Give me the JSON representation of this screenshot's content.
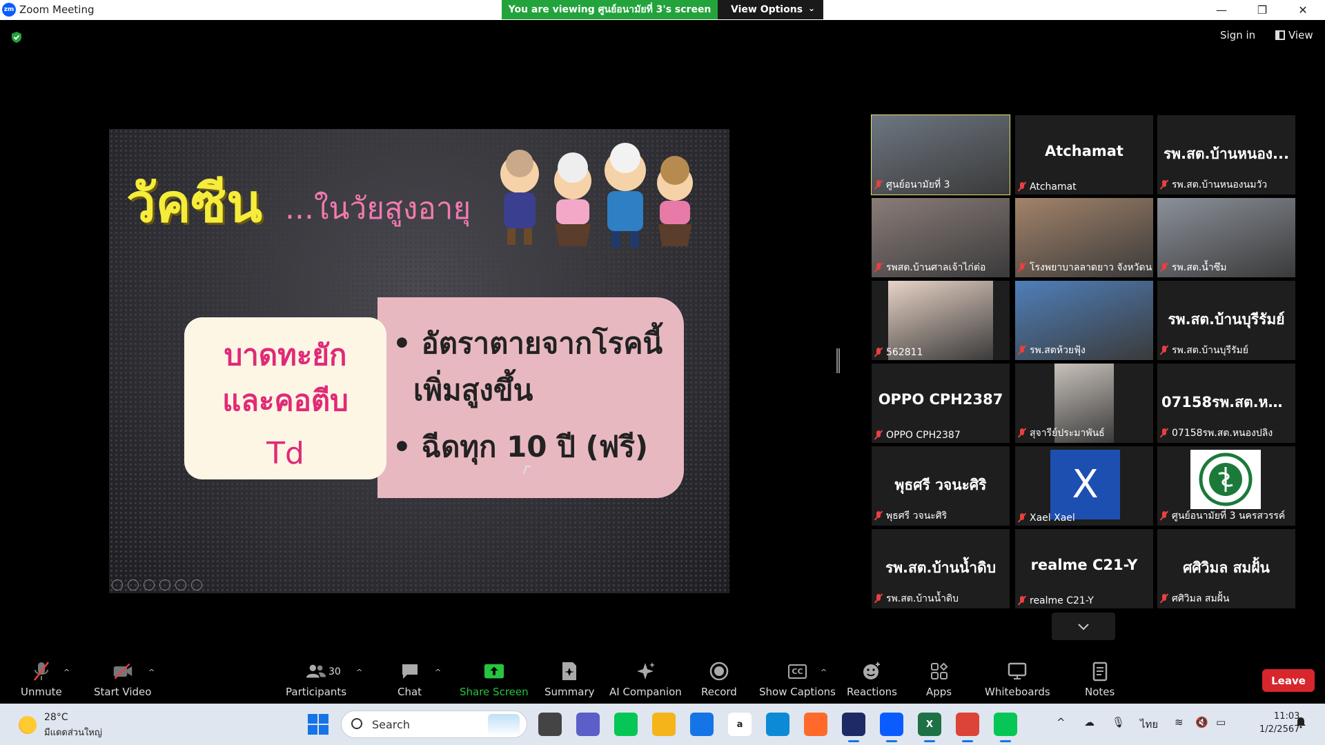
{
  "window": {
    "app_title": "Zoom Meeting",
    "logo_text": "zm",
    "minimize": "—",
    "restore": "❐",
    "close": "✕"
  },
  "banner": {
    "viewing_text": "You are viewing ศูนย์อนามัยที่ 3's screen",
    "view_options_label": "View Options"
  },
  "header": {
    "sign_in": "Sign in",
    "view": "View"
  },
  "slide": {
    "title_main": "วัคซีน",
    "title_sub": "...ในวัยสูงอายุ",
    "card_left_line1": "บาดทะยัก",
    "card_left_line2": "และคอตีบ",
    "card_left_line3": "Td",
    "bullet1_line1": "• อัตราตายจากโรคนี้",
    "bullet1_line2": "เพิ่มสูงขึ้น",
    "bullet2": "• ฉีดทุก 10 ปี (ฟรี)"
  },
  "participants": [
    {
      "display_name": "ศูนย์อนามัยที่ 3",
      "big_label": "",
      "tile_type": "video",
      "active": true,
      "bg": "#6d7681"
    },
    {
      "display_name": "Atchamat",
      "big_label": "Atchamat",
      "tile_type": "name"
    },
    {
      "display_name": "รพ.สต.บ้านหนองนมวัว",
      "big_label": "รพ.สต.บ้านหนอง...",
      "tile_type": "name"
    },
    {
      "display_name": "รพสต.บ้านศาลเจ้าไก่ต่อ",
      "big_label": "",
      "tile_type": "video",
      "bg": "#8a7c78"
    },
    {
      "display_name": "โรงพยาบาลลาดยาว จังหวัดนค...",
      "big_label": "",
      "tile_type": "video",
      "bg": "#a3836a"
    },
    {
      "display_name": "รพ.สต.น้ำซึม",
      "big_label": "",
      "tile_type": "video",
      "bg": "#8b9099"
    },
    {
      "display_name": "562811",
      "big_label": "",
      "tile_type": "video-narrow",
      "bg": "#e8d3c6"
    },
    {
      "display_name": "รพ.สตห้วยฟุ้ง",
      "big_label": "",
      "tile_type": "video",
      "bg": "#4f7fb9"
    },
    {
      "display_name": "รพ.สต.บ้านบุรีรัมย์",
      "big_label": "รพ.สต.บ้านบุรีรัมย์",
      "tile_type": "name"
    },
    {
      "display_name": "OPPO CPH2387",
      "big_label": "OPPO CPH2387",
      "tile_type": "name"
    },
    {
      "display_name": "สุจารีย์ประมาพันธ์",
      "big_label": "",
      "tile_type": "video-portrait",
      "bg": "#c9c2bb"
    },
    {
      "display_name": "07158รพ.สต.หนองปลิง",
      "big_label": "07158รพ.สต.หน...",
      "tile_type": "name"
    },
    {
      "display_name": "พุธศรี วจนะศิริ",
      "big_label": "พุธศรี วจนะศิริ",
      "tile_type": "name"
    },
    {
      "display_name": "Xael Xael",
      "big_label": "X",
      "tile_type": "avatar"
    },
    {
      "display_name": "ศูนย์อนามัยที่ 3 นครสวรรค์",
      "big_label": "",
      "tile_type": "logo"
    },
    {
      "display_name": "รพ.สต.บ้านน้ำดิบ",
      "big_label": "รพ.สต.บ้านน้ำดิบ",
      "tile_type": "name"
    },
    {
      "display_name": "realme C21-Y",
      "big_label": "realme C21-Y",
      "tile_type": "name"
    },
    {
      "display_name": "ศศิวิมล สมฝั้น",
      "big_label": "ศศิวิมล สมฝั้น",
      "tile_type": "name"
    }
  ],
  "toolbar": {
    "unmute": "Unmute",
    "start_video": "Start Video",
    "participants": "Participants",
    "participants_count": "30",
    "chat": "Chat",
    "share_screen": "Share Screen",
    "summary": "Summary",
    "ai_companion": "AI Companion",
    "record": "Record",
    "show_captions": "Show Captions",
    "captions_icon_text": "CC",
    "reactions": "Reactions",
    "apps": "Apps",
    "whiteboards": "Whiteboards",
    "notes": "Notes",
    "leave": "Leave"
  },
  "taskbar": {
    "temperature": "28°C",
    "location": "มีแดดส่วนใหญ่",
    "search_label": "Search",
    "language": "ไทย",
    "time": "11:03",
    "date": "1/2/2567"
  },
  "colors": {
    "share_green": "#23a33b",
    "leave_red": "#d7262c",
    "active_speaker": "#e8e26a",
    "mute_red": "#e84040"
  }
}
